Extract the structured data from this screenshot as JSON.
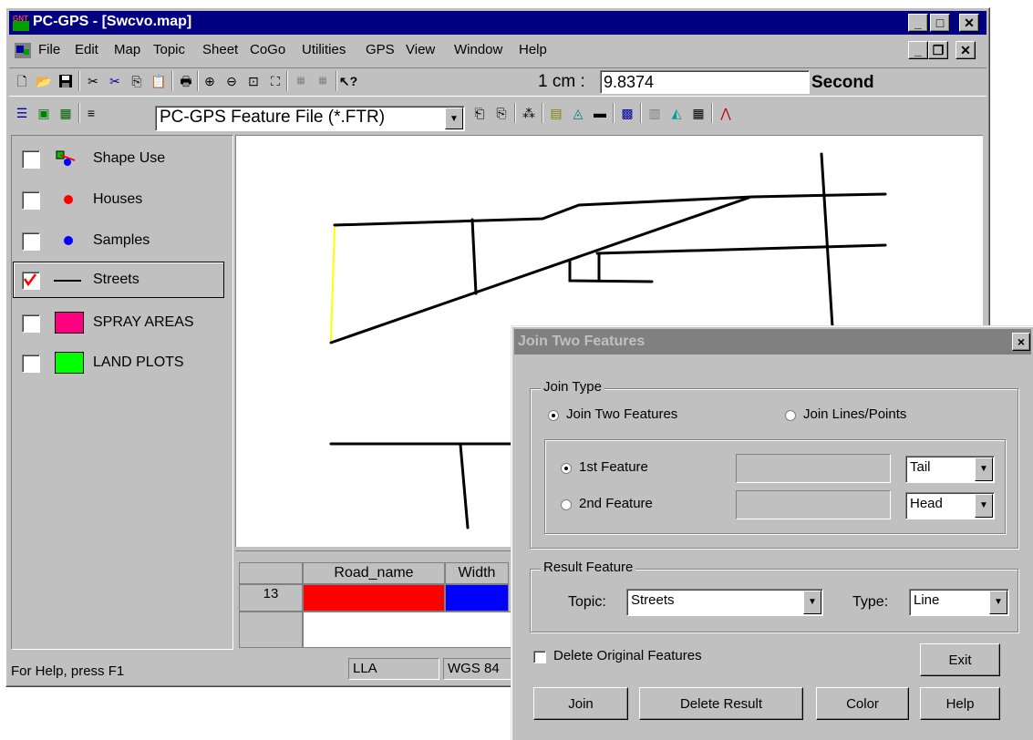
{
  "app": {
    "title": "PC-GPS - [Swcvo.map]"
  },
  "menu": {
    "items": [
      "File",
      "Edit",
      "Map",
      "Topic",
      "Sheet",
      "CoGo",
      "Utilities",
      "GPS",
      "View",
      "Window",
      "Help"
    ]
  },
  "toolbar": {
    "scale_label": "1 cm :",
    "scale_value": "9.8374",
    "scale_unit": "Second"
  },
  "toolbar2": {
    "file_type": "PC-GPS Feature File (*.FTR)"
  },
  "layers": [
    {
      "label": "Shape Use",
      "checked": false,
      "symbol": "shape-use-icon"
    },
    {
      "label": "Houses",
      "checked": false,
      "symbol": "red-dot",
      "color": "#ff0000"
    },
    {
      "label": "Samples",
      "checked": false,
      "symbol": "blue-dot",
      "color": "#0000ff"
    },
    {
      "label": "Streets",
      "checked": true,
      "symbol": "line"
    },
    {
      "label": "SPRAY AREAS",
      "checked": false,
      "symbol": "swatch",
      "color": "#ff0080"
    },
    {
      "label": "LAND PLOTS",
      "checked": false,
      "symbol": "swatch",
      "color": "#00ff00"
    }
  ],
  "table": {
    "headers": [
      "",
      "Road_name",
      "Width"
    ],
    "rows": [
      [
        "13",
        "",
        ""
      ]
    ]
  },
  "status": {
    "help": "For Help, press F1",
    "coord": "LLA",
    "datum": "WGS 84"
  },
  "dialog": {
    "title": "Join Two Features",
    "join_type_label": "Join Type",
    "opt_join_two": "Join Two Features",
    "opt_join_lines": "Join Lines/Points",
    "first_feature": "1st Feature",
    "second_feature": "2nd Feature",
    "first_end": "Tail",
    "second_end": "Head",
    "result_label": "Result Feature",
    "topic_label": "Topic:",
    "topic_value": "Streets",
    "type_label": "Type:",
    "type_value": "Line",
    "delete_original": "Delete Original Features",
    "exit": "Exit",
    "join": "Join",
    "delete_result": "Delete Result",
    "color": "Color",
    "help": "Help",
    "close": "×"
  },
  "colors": {
    "titlebar": "#000080",
    "road_highlight": "#ffff00",
    "cell_red": "#ff0000",
    "cell_blue": "#0000ff"
  }
}
